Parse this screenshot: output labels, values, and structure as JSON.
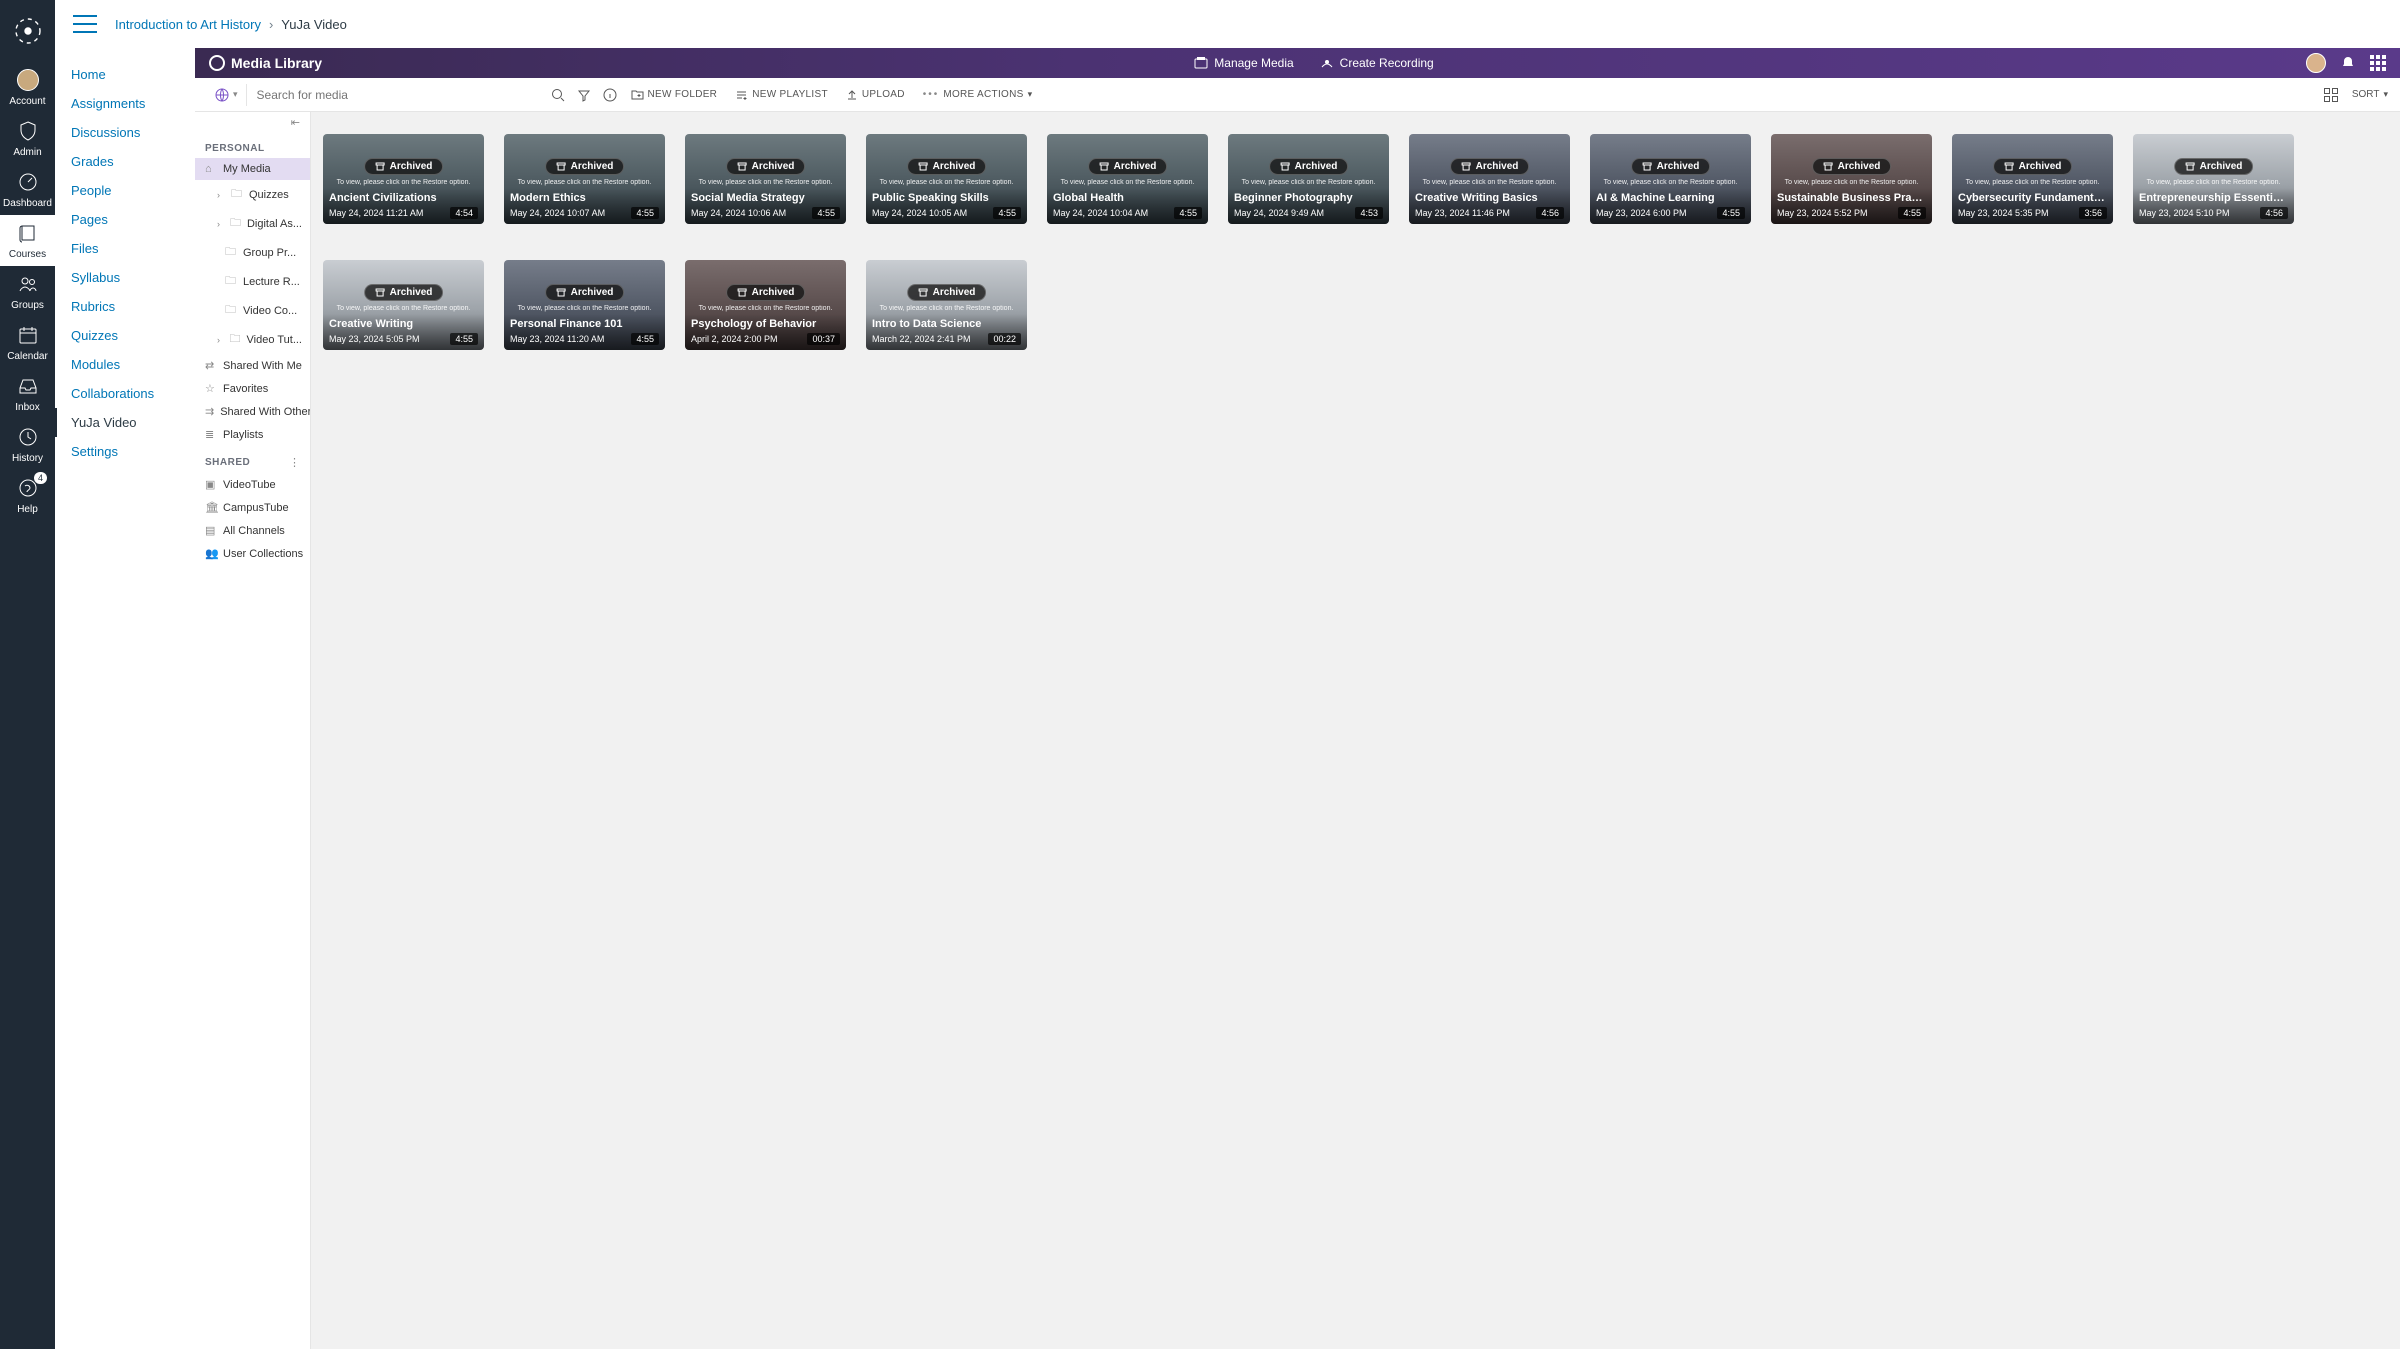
{
  "breadcrumb": {
    "course": "Introduction to Art History",
    "page": "YuJa Video"
  },
  "globalNav": {
    "items": [
      {
        "key": "account",
        "label": "Account"
      },
      {
        "key": "admin",
        "label": "Admin"
      },
      {
        "key": "dashboard",
        "label": "Dashboard"
      },
      {
        "key": "courses",
        "label": "Courses",
        "active": true
      },
      {
        "key": "groups",
        "label": "Groups"
      },
      {
        "key": "calendar",
        "label": "Calendar"
      },
      {
        "key": "inbox",
        "label": "Inbox"
      },
      {
        "key": "history",
        "label": "History"
      },
      {
        "key": "help",
        "label": "Help",
        "badge": "4"
      }
    ]
  },
  "courseNav": {
    "items": [
      "Home",
      "Assignments",
      "Discussions",
      "Grades",
      "People",
      "Pages",
      "Files",
      "Syllabus",
      "Rubrics",
      "Quizzes",
      "Modules",
      "Collaborations",
      "YuJa Video",
      "Settings"
    ],
    "active": "YuJa Video"
  },
  "yuja": {
    "brand": "Media Library",
    "header": {
      "manage": "Manage Media",
      "create": "Create Recording"
    },
    "toolbar": {
      "searchPlaceholder": "Search for media",
      "newFolder": "NEW FOLDER",
      "newPlaylist": "NEW PLAYLIST",
      "upload": "UPLOAD",
      "moreActions": "MORE ACTIONS",
      "sort": "SORT"
    },
    "side": {
      "personal": "PERSONAL",
      "shared": "SHARED",
      "rows": {
        "myMedia": "My Media",
        "quizzes": "Quizzes",
        "digital": "Digital As...",
        "group": "Group Pr...",
        "lecture": "Lecture R...",
        "videoCo": "Video Co...",
        "videoTut": "Video Tut...",
        "sharedWithMe": "Shared With Me",
        "favorites": "Favorites",
        "sharedWithOthers": "Shared With Others",
        "playlists": "Playlists",
        "videoTube": "VideoTube",
        "campusTube": "CampusTube",
        "allChannels": "All Channels",
        "userCollections": "User Collections"
      }
    },
    "card": {
      "archived": "Archived",
      "restoreNote": "To view, please click on the Restore option."
    },
    "videos": [
      {
        "title": "Ancient Civilizations",
        "date": "May 24, 2024 11:21 AM",
        "dur": "4:54",
        "cls": ""
      },
      {
        "title": "Modern Ethics",
        "date": "May 24, 2024 10:07 AM",
        "dur": "4:55",
        "cls": ""
      },
      {
        "title": "Social Media Strategy",
        "date": "May 24, 2024 10:06 AM",
        "dur": "4:55",
        "cls": ""
      },
      {
        "title": "Public Speaking Skills",
        "date": "May 24, 2024 10:05 AM",
        "dur": "4:55",
        "cls": ""
      },
      {
        "title": "Global Health",
        "date": "May 24, 2024 10:04 AM",
        "dur": "4:55",
        "cls": ""
      },
      {
        "title": "Beginner Photography",
        "date": "May 24, 2024 9:49 AM",
        "dur": "4:53",
        "cls": ""
      },
      {
        "title": "Creative Writing Basics",
        "date": "May 23, 2024 11:46 PM",
        "dur": "4:56",
        "cls": "alt3"
      },
      {
        "title": "AI & Machine Learning",
        "date": "May 23, 2024 6:00 PM",
        "dur": "4:55",
        "cls": "alt3"
      },
      {
        "title": "Sustainable Business Practices",
        "date": "May 23, 2024 5:52 PM",
        "dur": "4:55",
        "cls": "alt1"
      },
      {
        "title": "Cybersecurity Fundamentals",
        "date": "May 23, 2024 5:35 PM",
        "dur": "3:56",
        "cls": "alt3"
      },
      {
        "title": "Entrepreneurship Essentials",
        "date": "May 23, 2024 5:10 PM",
        "dur": "4:56",
        "cls": "alt2"
      },
      {
        "title": "Creative Writing",
        "date": "May 23, 2024 5:05 PM",
        "dur": "4:55",
        "cls": "alt2"
      },
      {
        "title": "Personal Finance 101",
        "date": "May 23, 2024 11:20 AM",
        "dur": "4:55",
        "cls": "alt3"
      },
      {
        "title": "Psychology of Behavior",
        "date": "April 2, 2024 2:00 PM",
        "dur": "00:37",
        "cls": "alt1"
      },
      {
        "title": "Intro to Data Science",
        "date": "March 22, 2024 2:41 PM",
        "dur": "00:22",
        "cls": "alt2"
      }
    ]
  }
}
